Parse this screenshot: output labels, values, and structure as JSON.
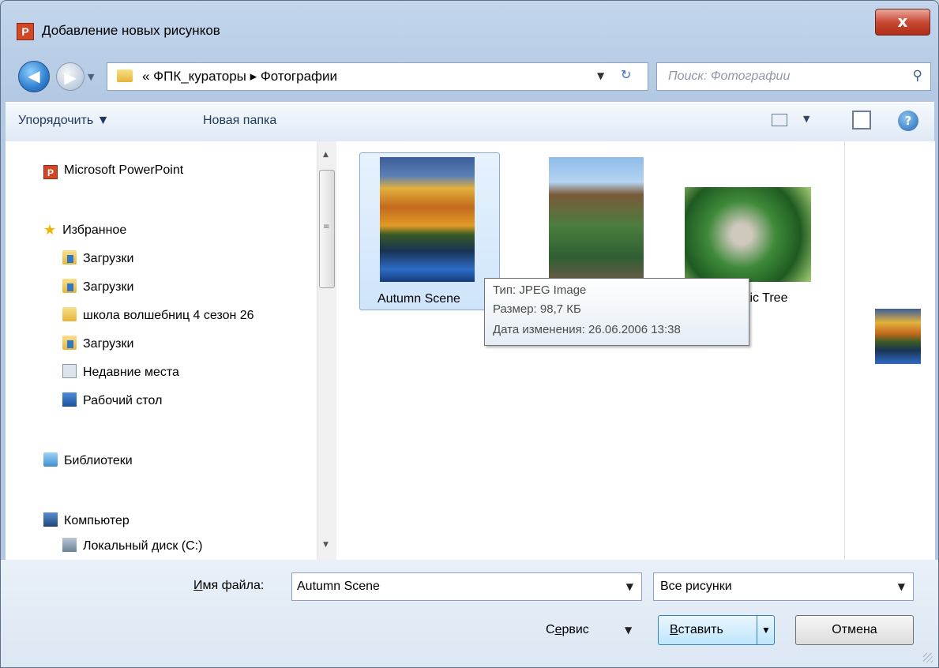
{
  "window": {
    "title": "Добавление новых рисунков",
    "app_icon_letter": "P",
    "close_glyph": "x"
  },
  "nav": {
    "back_glyph": "◀",
    "forward_glyph": "▶",
    "history_glyph": "▼",
    "breadcrumb": "« ФПК_кураторы ▸ Фотографии",
    "address_drop_glyph": "▼",
    "refresh_glyph": "↻",
    "search_placeholder": "Поиск: Фотографии",
    "search_glyph": "⚲"
  },
  "toolbar": {
    "organize": "Упорядочить ▼",
    "new_folder": "Новая папка",
    "view_drop_glyph": "▼",
    "help_glyph": "?"
  },
  "sidebar": {
    "items": [
      {
        "label": "Microsoft PowerPoint",
        "icon": "powerpoint-icon"
      },
      {
        "label": "Избранное",
        "icon": "star-icon"
      },
      {
        "label": "Загрузки",
        "icon": "downloads-icon"
      },
      {
        "label": "Загрузки",
        "icon": "downloads-icon"
      },
      {
        "label": "школа волшебниц 4 сезон 26",
        "icon": "folder-icon"
      },
      {
        "label": "Загрузки",
        "icon": "downloads-icon"
      },
      {
        "label": "Недавние места",
        "icon": "recent-places-icon"
      },
      {
        "label": "Рабочий стол",
        "icon": "desktop-icon"
      },
      {
        "label": "Библиотеки",
        "icon": "libraries-icon"
      },
      {
        "label": "Компьютер",
        "icon": "computer-icon"
      },
      {
        "label": "Локальный диск (C:)",
        "icon": "disk-icon"
      }
    ],
    "scroll_up": "▲",
    "scroll_down": "▼",
    "scroll_grip": "≡"
  },
  "files": [
    {
      "name": "Autumn Scene",
      "selected": true
    },
    {
      "name": "",
      "selected": false
    },
    {
      "name": "tic Tree",
      "selected": false
    }
  ],
  "tooltip": {
    "type": "Тип: JPEG Image",
    "size": "Размер: 98,7 КБ",
    "modified": "Дата изменения: 26.06.2006 13:38"
  },
  "footer": {
    "filename_label_accel": "И",
    "filename_label_rest": "мя файла:",
    "filename_value": "Autumn Scene",
    "filetype_value": "Все рисунки",
    "dropdown_glyph": "▼",
    "service_prefix": "С",
    "service_accel": "е",
    "service_rest": "рвис",
    "insert_accel": "В",
    "insert_rest": "ставить",
    "cancel": "Отмена"
  }
}
